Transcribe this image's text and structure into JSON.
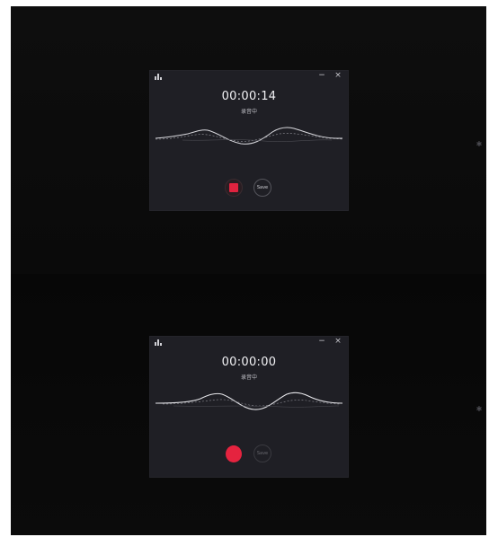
{
  "screens": [
    {
      "state": "recording",
      "app_icon": "audio-bars-icon",
      "minimize_label": "−",
      "close_label": "×",
      "timer": "00:00:14",
      "status": "录音中",
      "stop_icon": "stop-icon",
      "save_label": "Save",
      "side_icon": "settings-icon",
      "side_glyph": "✱",
      "accent_color": "#e0233f"
    },
    {
      "state": "idle",
      "app_icon": "audio-bars-icon",
      "minimize_label": "−",
      "close_label": "×",
      "timer": "00:00:00",
      "status": "录音中",
      "record_icon": "record-icon",
      "save_label": "Save",
      "side_icon": "settings-icon",
      "side_glyph": "✱",
      "accent_color": "#e5233f"
    }
  ]
}
